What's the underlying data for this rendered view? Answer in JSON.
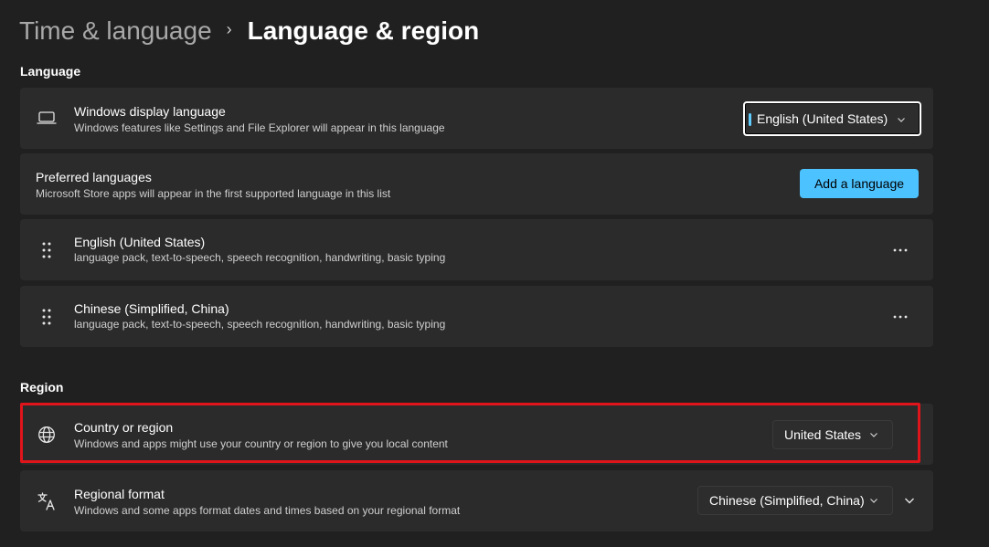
{
  "header": {
    "parent": "Time & language",
    "separator": "›",
    "current": "Language & region"
  },
  "language_section": {
    "title": "Language",
    "display_language": {
      "title": "Windows display language",
      "description": "Windows features like Settings and File Explorer will appear in this language",
      "selected": "English (United States)"
    },
    "preferred": {
      "title": "Preferred languages",
      "description": "Microsoft Store apps will appear in the first supported language in this list",
      "add_button": "Add a language"
    },
    "languages": [
      {
        "name": "English (United States)",
        "features": "language pack, text-to-speech, speech recognition, handwriting, basic typing"
      },
      {
        "name": "Chinese (Simplified, China)",
        "features": "language pack, text-to-speech, speech recognition, handwriting, basic typing"
      }
    ]
  },
  "region_section": {
    "title": "Region",
    "country": {
      "title": "Country or region",
      "description": "Windows and apps might use your country or region to give you local content",
      "selected": "United States"
    },
    "format": {
      "title": "Regional format",
      "description": "Windows and some apps format dates and times based on your regional format",
      "selected": "Chinese (Simplified, China)"
    }
  },
  "colors": {
    "background": "#202020",
    "card": "#2b2b2b",
    "accent": "#4cc2ff",
    "highlight": "#e0141b"
  },
  "icons": [
    "laptop-icon",
    "drag-handle-icon",
    "more-icon",
    "globe-icon",
    "language-format-icon",
    "chevron-down-icon",
    "chevron-right-icon"
  ]
}
